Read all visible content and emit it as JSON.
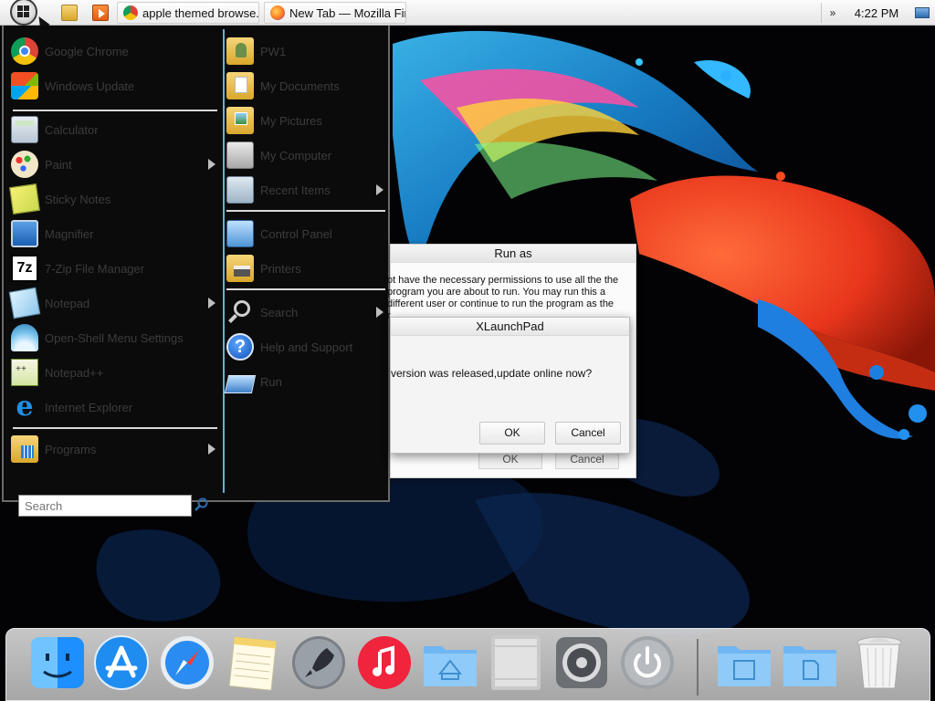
{
  "taskbar": {
    "buttons": [
      {
        "label": "apple themed browse...",
        "icon": "chrome-icon"
      },
      {
        "label": "New Tab — Mozilla Fir...",
        "icon": "firefox-icon"
      }
    ],
    "clock": "4:22 PM",
    "tray_chevron": "»"
  },
  "start_menu": {
    "left_items": [
      {
        "label": "Google Chrome",
        "icon": "chrome-icon"
      },
      {
        "label": "Windows Update",
        "icon": "windows-update-icon"
      },
      {
        "label": "Calculator",
        "icon": "calculator-icon"
      },
      {
        "label": "Paint",
        "icon": "paint-icon",
        "has_submenu": true
      },
      {
        "label": "Sticky Notes",
        "icon": "sticky-notes-icon"
      },
      {
        "label": "Magnifier",
        "icon": "magnifier-icon"
      },
      {
        "label": "7-Zip File Manager",
        "icon": "7zip-icon"
      },
      {
        "label": "Notepad",
        "icon": "notepad-icon",
        "has_submenu": true
      },
      {
        "label": "Open-Shell Menu Settings",
        "icon": "shell-icon"
      },
      {
        "label": "Notepad++",
        "icon": "notepadpp-icon"
      },
      {
        "label": "Internet Explorer",
        "icon": "ie-icon"
      },
      {
        "label": "Programs",
        "icon": "programs-icon",
        "has_submenu": true
      }
    ],
    "right_items": [
      {
        "label": "PW1",
        "icon": "user-folder-icon"
      },
      {
        "label": "My Documents",
        "icon": "documents-folder-icon"
      },
      {
        "label": "My Pictures",
        "icon": "pictures-folder-icon"
      },
      {
        "label": "My Computer",
        "icon": "computer-icon"
      },
      {
        "label": "Recent Items",
        "icon": "recent-items-icon",
        "has_submenu": true
      },
      {
        "label": "Control Panel",
        "icon": "control-panel-icon"
      },
      {
        "label": "Printers",
        "icon": "printers-icon"
      },
      {
        "label": "Search",
        "icon": "search-icon",
        "has_submenu": true
      },
      {
        "label": "Help and Support",
        "icon": "help-icon"
      },
      {
        "label": "Run",
        "icon": "run-icon"
      }
    ],
    "search_placeholder": "Search"
  },
  "run_as_dialog": {
    "title": "Run as",
    "message": "ot have the necessary permissions to use all the the program you are about to run. You may run this a different user or continue to run the program as the r.",
    "ok_label": "OK",
    "cancel_label": "Cancel"
  },
  "xlaunchpad_dialog": {
    "title": "XLaunchPad",
    "message": "version was released,update online now?",
    "ok_label": "OK",
    "cancel_label": "Cancel"
  },
  "dock": {
    "apps": [
      "finder-icon",
      "app-store-icon",
      "safari-icon",
      "notes-icon",
      "launchpad-icon",
      "itunes-icon",
      "applications-folder-icon",
      "mac-pro-icon",
      "system-preferences-icon",
      "power-icon",
      "documents-folder-icon",
      "downloads-folder-icon",
      "trash-icon"
    ]
  },
  "colors": {
    "menu_bg": "#0b0b0b",
    "menu_separator": "#d9d9d9",
    "menu_accent": "#5fb3d6",
    "dock_bg": "#cfcfcf"
  }
}
